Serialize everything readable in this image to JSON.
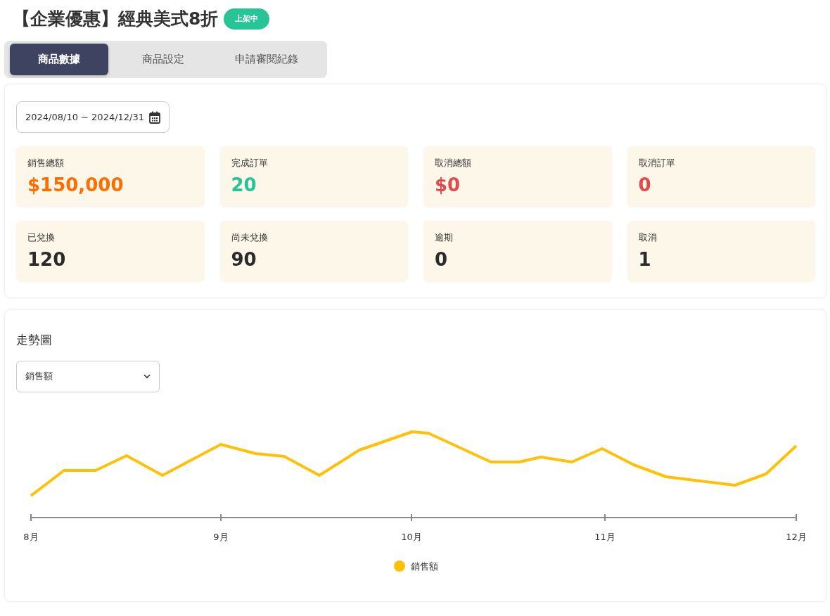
{
  "title": "【企業優惠】經典美式8折",
  "status_badge": "上架中",
  "tabs": [
    {
      "label": "商品數據",
      "selected": true
    },
    {
      "label": "商品設定",
      "selected": false
    },
    {
      "label": "申請審閱紀錄",
      "selected": false
    }
  ],
  "date_range": "2024/08/10 ~ 2024/12/31",
  "stats": [
    {
      "label": "銷售總額",
      "value": "$150,000",
      "color": "#ff6c00"
    },
    {
      "label": "完成訂單",
      "value": "20",
      "color": "#26c496"
    },
    {
      "label": "取消總額",
      "value": "$0",
      "color": "#e04a4a"
    },
    {
      "label": "取消訂單",
      "value": "0",
      "color": "#e04a4a"
    },
    {
      "label": "已兌換",
      "value": "120",
      "color": "#2b2b2b"
    },
    {
      "label": "尚未兌換",
      "value": "90",
      "color": "#2b2b2b"
    },
    {
      "label": "逾期",
      "value": "0",
      "color": "#2b2b2b"
    },
    {
      "label": "取消",
      "value": "1",
      "color": "#2b2b2b"
    }
  ],
  "trend": {
    "title": "走勢圖",
    "metric_select": "銷售額",
    "x_labels": [
      "8月",
      "9月",
      "10月",
      "11月",
      "12月"
    ],
    "legend": {
      "label": "銷售額",
      "color": "#ffc107"
    }
  }
}
